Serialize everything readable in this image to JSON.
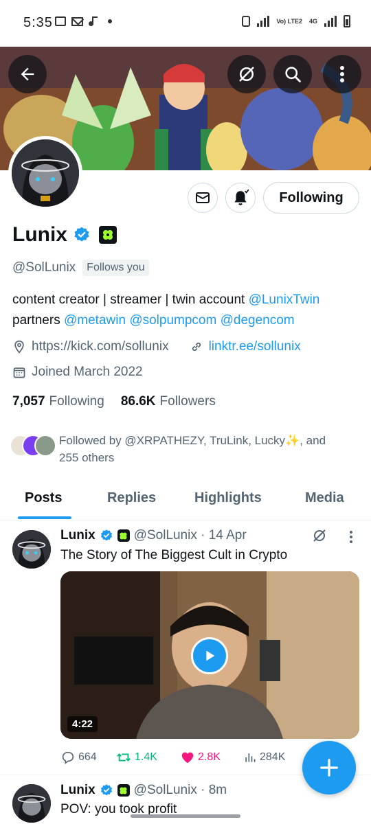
{
  "status_bar": {
    "time": "5:35",
    "network": "Vo) LTE2",
    "network_type": "4G"
  },
  "profile": {
    "display_name": "Lunix",
    "handle": "@SolLunix",
    "follows_you": "Follows you",
    "bio": {
      "line1_text": "content creator | streamer | twin account ",
      "line1_mention": "@LunixTwin",
      "line2_text": "partners ",
      "line2_mentions": [
        "@metawin",
        "@solpumpcom",
        "@degencom"
      ]
    },
    "website": "https://kick.com/sollunix",
    "linktree": "linktr.ee/sollunix",
    "joined": "Joined March 2022",
    "following_count": "7,057",
    "following_label": "Following",
    "followers_count": "86.6K",
    "followers_label": "Followers",
    "followed_by": "Followed by @XRPATHEZY, TruLink, Lucky✨, and 255 others",
    "follow_button": "Following"
  },
  "tabs": [
    "Posts",
    "Replies",
    "Highlights",
    "Media"
  ],
  "active_tab": "Posts",
  "posts": [
    {
      "name": "Lunix",
      "handle_time": "@SolLunix · 14 Apr",
      "text": "The Story of The Biggest Cult in Crypto",
      "video_duration": "4:22",
      "replies": "664",
      "reposts": "1.4K",
      "likes": "2.8K",
      "views": "284K"
    },
    {
      "name": "Lunix",
      "handle_time": "@SolLunix · 8m",
      "text": "POV: you took profit"
    }
  ],
  "colors": {
    "accent": "#1d9bf0",
    "repost": "#00ba7c",
    "like": "#f91880",
    "text": "#0f1419",
    "muted": "#536471"
  }
}
